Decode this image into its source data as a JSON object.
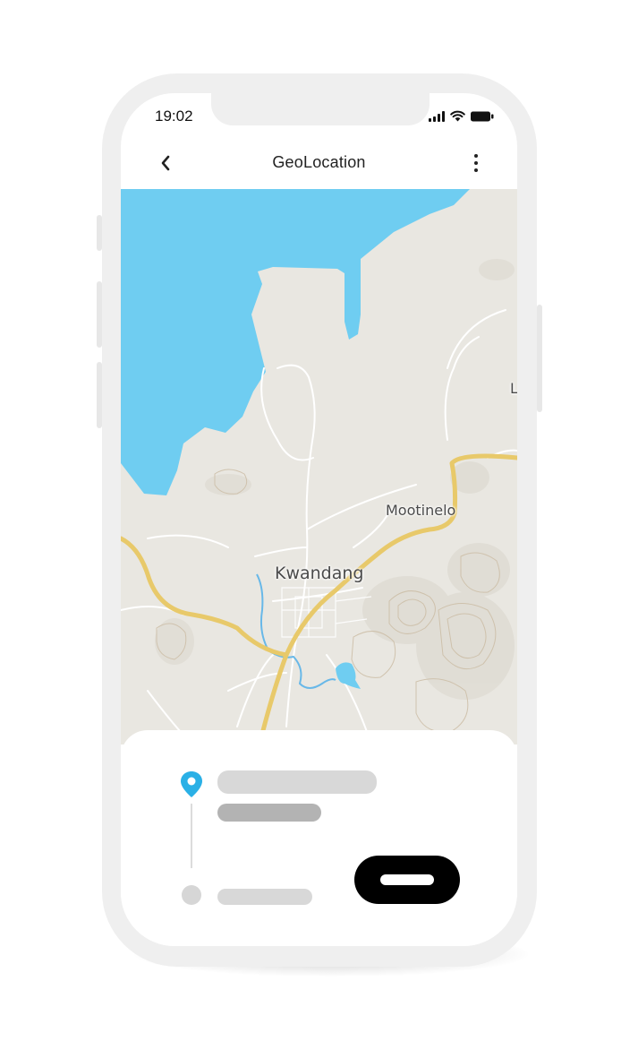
{
  "status_bar": {
    "time": "19:02",
    "icons": [
      "signal-icon",
      "wifi-icon",
      "battery-icon"
    ]
  },
  "app_bar": {
    "title": "GeoLocation",
    "back_icon": "chevron-left-icon",
    "menu_icon": "more-vertical-icon"
  },
  "map": {
    "labels": [
      "Mootinelo",
      "Kwandang",
      "L"
    ],
    "colors": {
      "water": "#6fcdf1",
      "land": "#e9e7e1",
      "road_major": "#e8c96a",
      "road_minor": "#ffffff",
      "river": "#68b8e8"
    }
  },
  "bottom_sheet": {
    "pickup_icon": "location-pin-icon",
    "accent": "#2ab0e6",
    "primary_button": "confirm-button"
  }
}
